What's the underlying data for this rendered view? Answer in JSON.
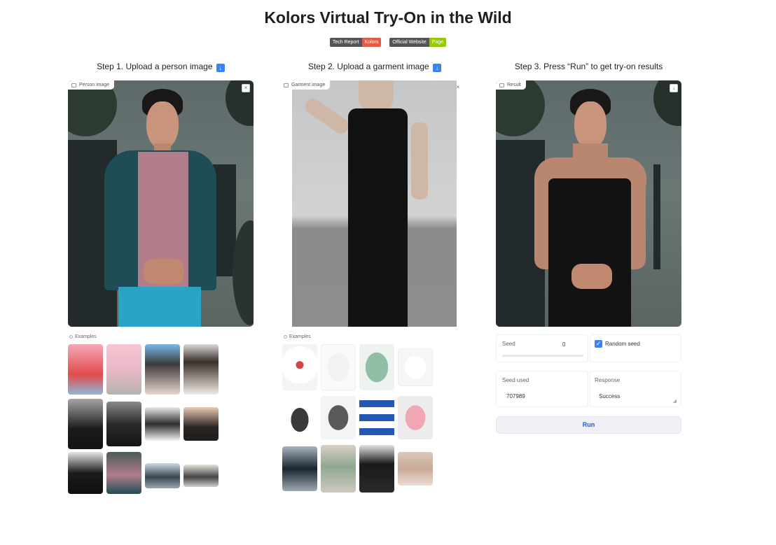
{
  "title": "Kolors Virtual Try-On in the Wild",
  "badges": [
    {
      "left": "Tech Report",
      "right": "Kolors",
      "color": "#e05d44"
    },
    {
      "left": "Official Website",
      "right": "Page",
      "color": "#97ca00"
    }
  ],
  "steps": {
    "step1": "Step 1. Upload a person image",
    "step2": "Step 2. Upload a garment image",
    "step3": "Step 3. Press “Run” to get try-on results"
  },
  "panels": {
    "person_label": "Person image",
    "garment_label": "Garment image",
    "result_label": "Result"
  },
  "examples_label": "Examples",
  "controls": {
    "seed_label": "Seed",
    "seed_value": "0",
    "random_seed_label": "Random seed",
    "random_seed_checked": true,
    "seed_used_label": "Seed used",
    "seed_used_value": "707989",
    "response_label": "Response",
    "response_value": "Success",
    "run_label": "Run"
  },
  "icons": {
    "download": "down-arrow-icon",
    "image": "image-icon",
    "close": "close-icon",
    "checkbox": "check-icon"
  },
  "colors": {
    "accent_blue": "#3b82f6",
    "run_text": "#2b50e0"
  }
}
